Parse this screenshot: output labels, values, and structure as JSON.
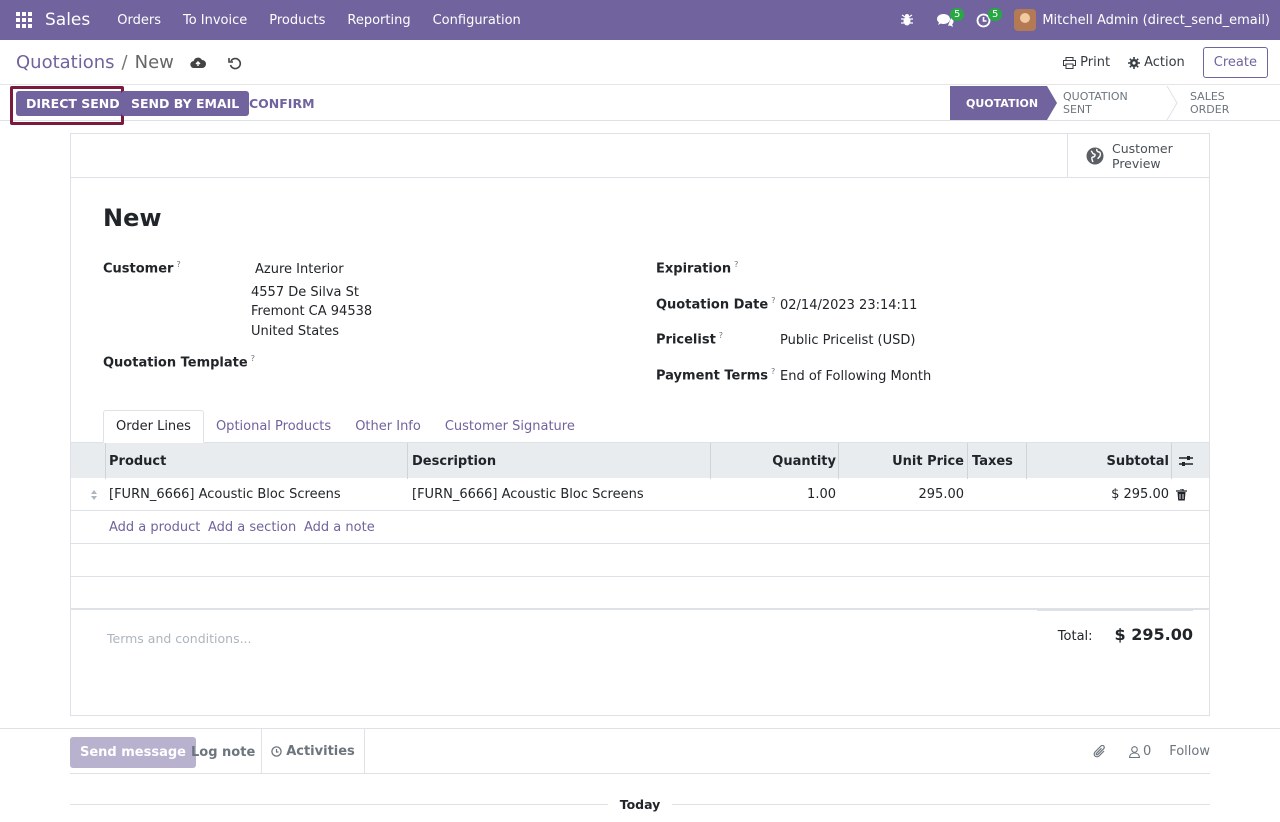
{
  "navbar": {
    "brand": "Sales",
    "menu": [
      "Orders",
      "To Invoice",
      "Products",
      "Reporting",
      "Configuration"
    ],
    "messages_badge": "5",
    "activities_badge": "5",
    "user": "Mitchell Admin (direct_send_email)"
  },
  "breadcrumb": {
    "parent": "Quotations",
    "separator": "/",
    "current": "New"
  },
  "control": {
    "print_label": "Print",
    "action_label": "Action",
    "create_label": "Create"
  },
  "statusbar": {
    "direct_send": "DIRECT SEND",
    "send_by_email": "SEND BY EMAIL",
    "confirm": "CONFIRM",
    "stages": [
      "QUOTATION",
      "QUOTATION SENT",
      "SALES ORDER"
    ],
    "active_stage": "QUOTATION"
  },
  "smart_button": {
    "line1": "Customer",
    "line2": "Preview"
  },
  "form": {
    "title": "New",
    "customer_label": "Customer",
    "customer_name": "Azure Interior",
    "customer_addr1": "4557 De Silva St",
    "customer_addr2": "Fremont CA 94538",
    "customer_addr3": "United States",
    "template_label": "Quotation Template",
    "expiration_label": "Expiration",
    "quotation_date_label": "Quotation Date",
    "quotation_date": "02/14/2023 23:14:11",
    "pricelist_label": "Pricelist",
    "pricelist": "Public Pricelist (USD)",
    "payment_terms_label": "Payment Terms",
    "payment_terms": "End of Following Month",
    "help_mark": "?"
  },
  "tabs": [
    "Order Lines",
    "Optional Products",
    "Other Info",
    "Customer Signature"
  ],
  "table": {
    "headers": {
      "product": "Product",
      "description": "Description",
      "quantity": "Quantity",
      "unit_price": "Unit Price",
      "taxes": "Taxes",
      "subtotal": "Subtotal"
    },
    "rows": [
      {
        "product": "[FURN_6666] Acoustic Bloc Screens",
        "description": "[FURN_6666] Acoustic Bloc Screens",
        "quantity": "1.00",
        "unit_price": "295.00",
        "taxes": "",
        "subtotal": "$ 295.00"
      }
    ],
    "add_product": "Add a product",
    "add_section": "Add a section",
    "add_note": "Add a note"
  },
  "terms_placeholder": "Terms and conditions...",
  "totals": {
    "label": "Total:",
    "value": "$ 295.00"
  },
  "chatter": {
    "send_message": "Send message",
    "log_note": "Log note",
    "activities": "Activities",
    "followers_count": "0",
    "follow": "Follow",
    "today": "Today"
  },
  "colors": {
    "primary": "#71639e",
    "highlight_border": "#7a1a3d",
    "badge": "#28a745"
  }
}
